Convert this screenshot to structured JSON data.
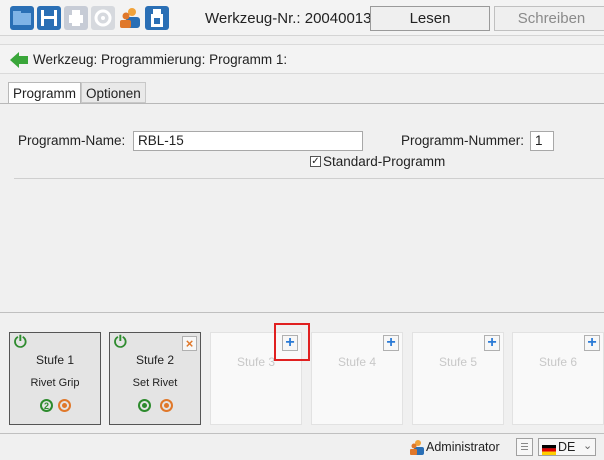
{
  "toolbar": {
    "tool_number": "Werkzeug-Nr.: 20040013",
    "read_label": "Lesen",
    "write_label": "Schreiben",
    "icons": [
      "folder-open-icon",
      "save-icon",
      "print-icon",
      "settings-gear-icon",
      "users-icon",
      "usb-drive-icon"
    ]
  },
  "breadcrumb": {
    "text": "Werkzeug: Programmierung: Programm 1:"
  },
  "tabs": [
    {
      "label": "Programm",
      "active": true
    },
    {
      "label": "Optionen",
      "active": false
    }
  ],
  "form": {
    "name_label": "Programm-Name:",
    "name_value": "RBL-15",
    "number_label": "Programm-Nummer:",
    "number_value": "1",
    "standard_label": "Standard-Programm",
    "standard_checked": true
  },
  "stages": [
    {
      "title": "Stufe 1",
      "subtitle": "Rivet Grip",
      "state": "active",
      "badge": "2"
    },
    {
      "title": "Stufe 2",
      "subtitle": "Set Rivet",
      "state": "active"
    },
    {
      "title": "Stufe 3",
      "state": "empty"
    },
    {
      "title": "Stufe 4",
      "state": "empty"
    },
    {
      "title": "Stufe 5",
      "state": "empty"
    },
    {
      "title": "Stufe 6",
      "state": "empty"
    }
  ],
  "status": {
    "user": "Administrator",
    "language": "DE"
  },
  "colors": {
    "accent_green": "#2e8b2e",
    "accent_orange": "#e0782a",
    "accent_blue": "#2a7ad6",
    "highlight": "#e02020"
  }
}
